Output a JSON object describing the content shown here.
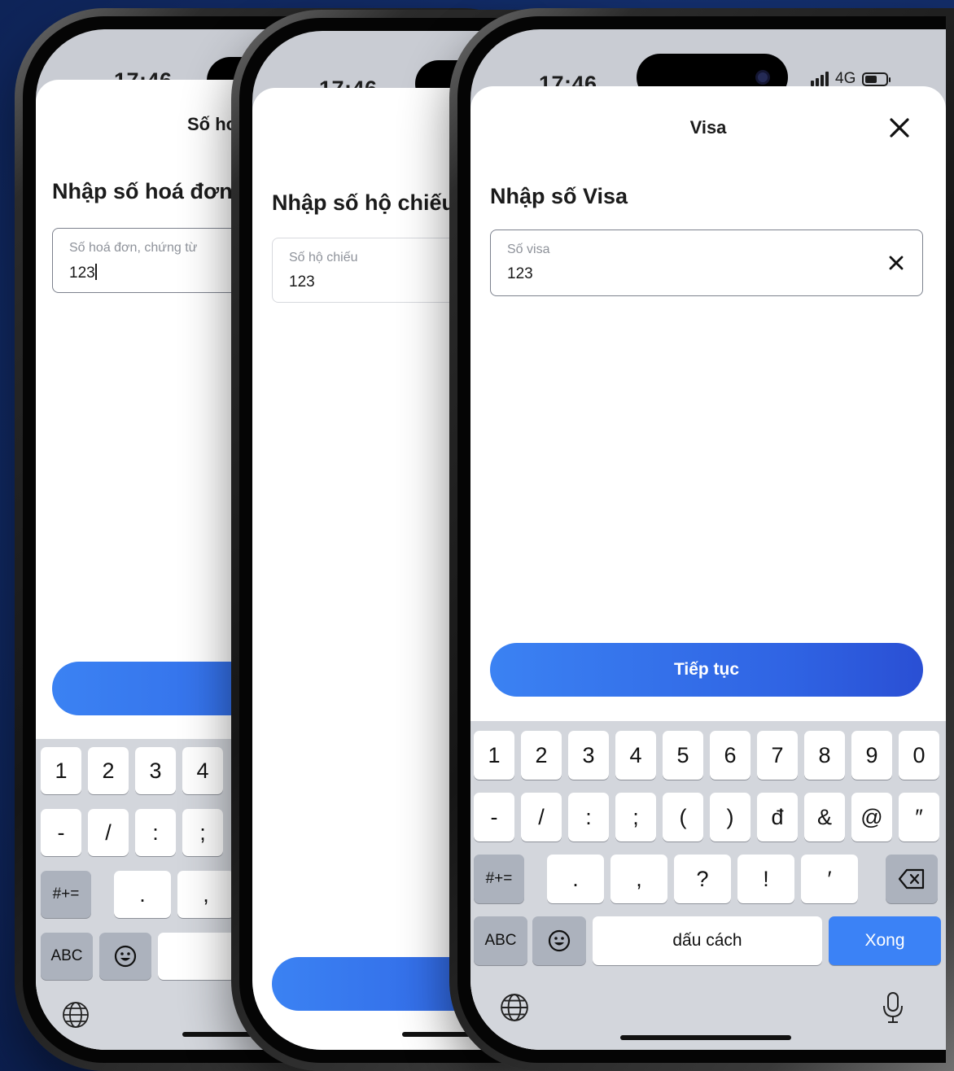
{
  "phones": [
    {
      "time": "17:46",
      "title": "Số ho",
      "heading": "Nhập số hoá đơn",
      "field": {
        "placeholder": "Số hoá đơn, chứng từ",
        "value": "123"
      },
      "keyboard": {
        "row1": [
          "1",
          "2",
          "3",
          "4"
        ],
        "row2": [
          "-",
          "/",
          ":",
          ";"
        ],
        "row3": [
          "#+=",
          ".",
          ","
        ],
        "row4": [
          "ABC"
        ]
      }
    },
    {
      "time": "17:46",
      "heading": "Nhập số hộ chiếu",
      "field": {
        "placeholder": "Số hộ chiếu",
        "value": "123"
      }
    },
    {
      "time": "17:46",
      "network": "4G",
      "title": "Visa",
      "heading": "Nhập số Visa",
      "field": {
        "placeholder": "Số visa",
        "value": "123"
      },
      "button_label": "Tiếp tục",
      "keyboard": {
        "row1": [
          "1",
          "2",
          "3",
          "4",
          "5",
          "6",
          "7",
          "8",
          "9",
          "0"
        ],
        "row2": [
          "-",
          "/",
          ":",
          ";",
          "(",
          ")",
          "đ",
          "&",
          "@",
          "″"
        ],
        "row3": [
          "#+=",
          ".",
          ",",
          "?",
          "!",
          "′"
        ],
        "abc": "ABC",
        "space": "dấu cách",
        "done": "Xong"
      }
    }
  ],
  "icons": [
    "close-icon",
    "clear-icon",
    "emoji-icon",
    "globe-icon",
    "microphone-icon",
    "backspace-icon",
    "signal-icon",
    "battery-icon",
    "camera-dot-icon"
  ],
  "colors": {
    "accent": "#3b82f6",
    "background": "#14306f"
  }
}
